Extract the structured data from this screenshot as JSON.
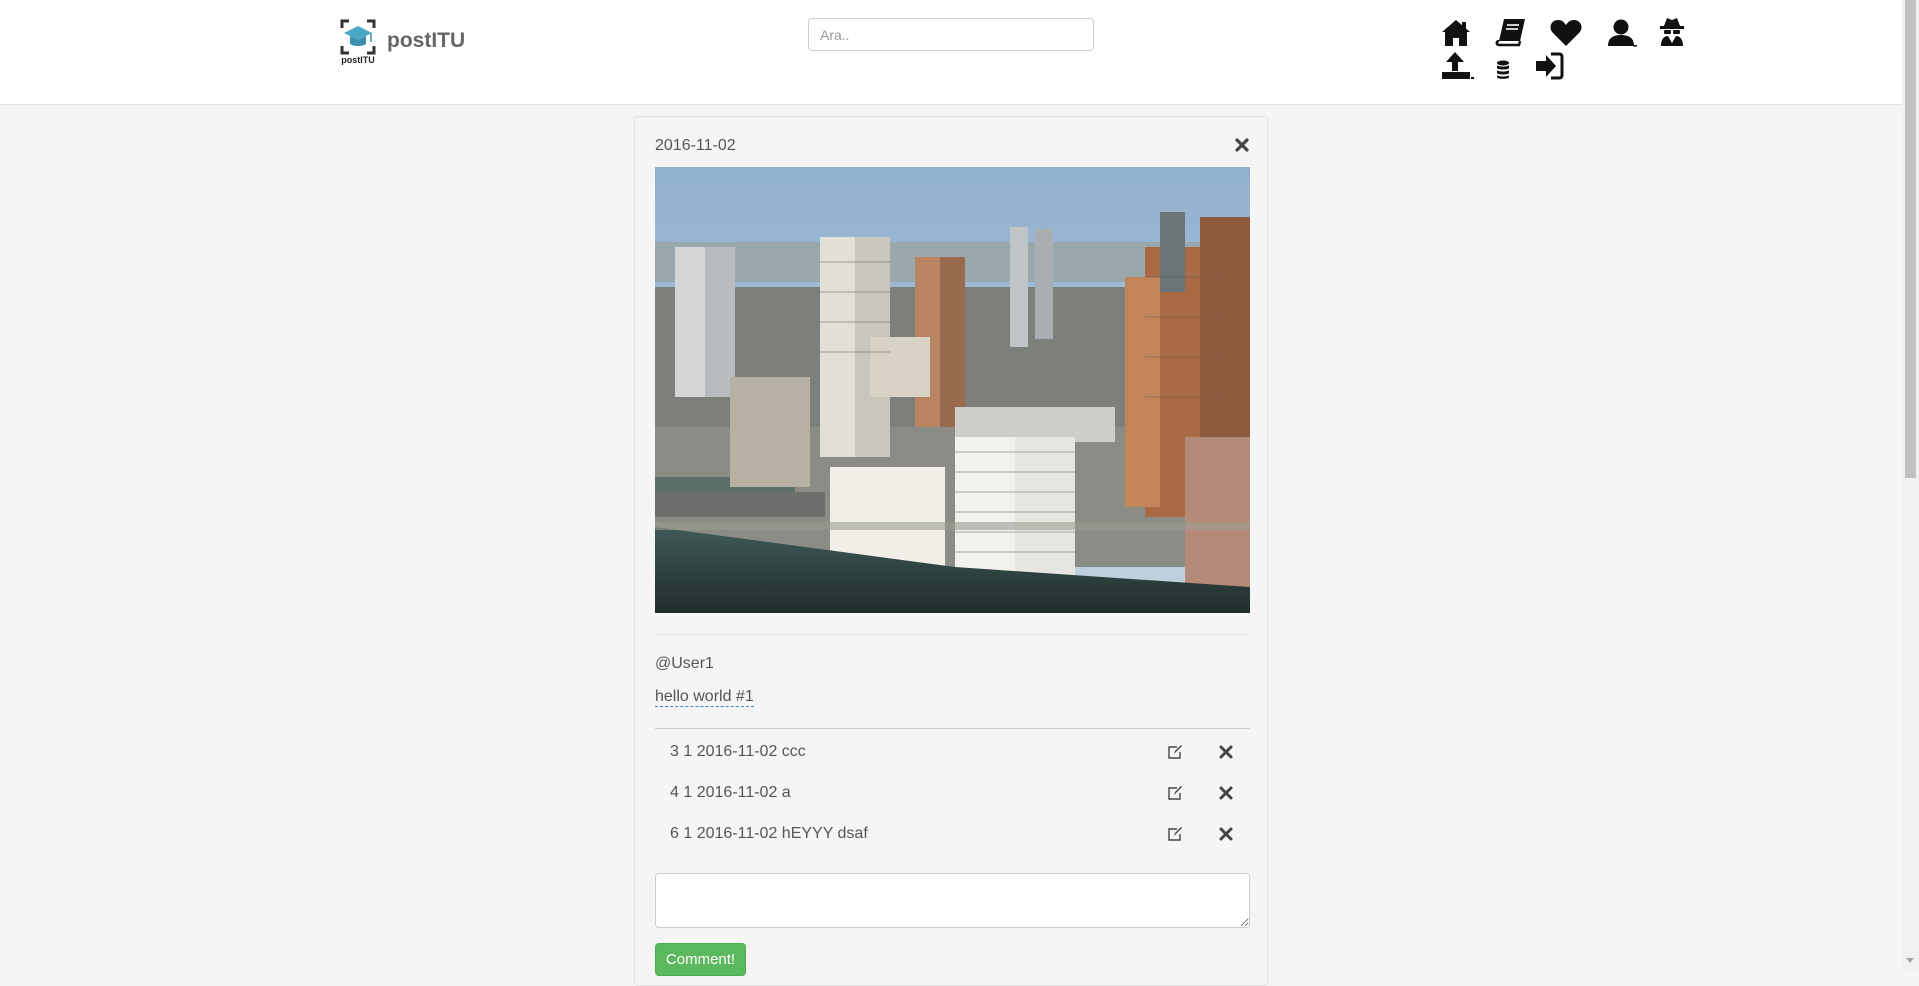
{
  "brand": {
    "name": "postITU",
    "logo_text": "postITU"
  },
  "search": {
    "placeholder": "Ara.."
  },
  "nav_icons": [
    "home-icon",
    "book-icon",
    "heart-icon",
    "user-icon",
    "spy-icon",
    "upload-icon",
    "database-icon",
    "sign-in-icon"
  ],
  "post": {
    "date": "2016-11-02",
    "author": "@User1",
    "caption": "hello world #1",
    "comments": [
      {
        "text": "3 1 2016-11-02 ccc"
      },
      {
        "text": "4 1 2016-11-02 a"
      },
      {
        "text": "6 1 2016-11-02 hEYYY dsaf"
      }
    ],
    "comment_placeholder": "",
    "comment_button": "Comment!"
  },
  "colors": {
    "accent_green": "#5cb85c",
    "logo_teal": "#4aa8c6",
    "link_dash": "#3a87d8"
  }
}
